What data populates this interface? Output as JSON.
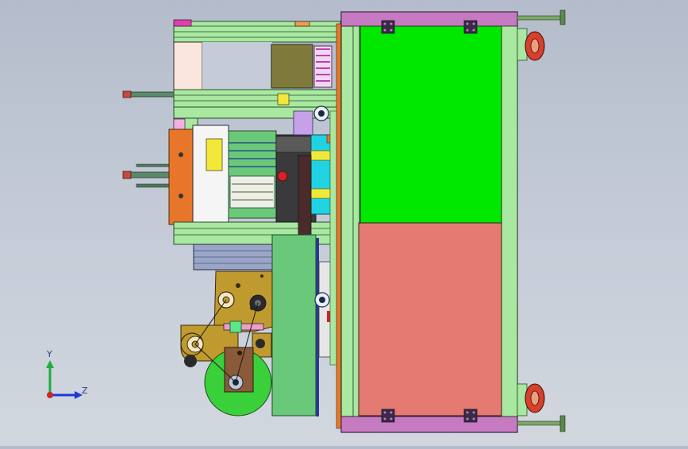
{
  "viewport": {
    "background_top": "#b4bccb",
    "background_bottom": "#d2d7df"
  },
  "triad": {
    "y_label": "Y",
    "z_label": "Z",
    "y_color": "#1fae3b",
    "z_color": "#1f39d6",
    "x_color": "#c8262a"
  },
  "model": {
    "palette": {
      "frame_green": "#a8e8a0",
      "panel_green": "#00e800",
      "panel_salmon": "#e57a72",
      "frame_purple": "#c67ac2",
      "orange": "#e8762a",
      "cyan": "#1fd3e3",
      "yellow": "#f2e83a",
      "olive": "#7f7a3c",
      "tan": "#bf9a2e",
      "brown": "#8a5a3a",
      "wheel_green": "#3ad03a",
      "teal_rod": "#5a8a6a",
      "red_wheel": "#d8402a"
    }
  }
}
